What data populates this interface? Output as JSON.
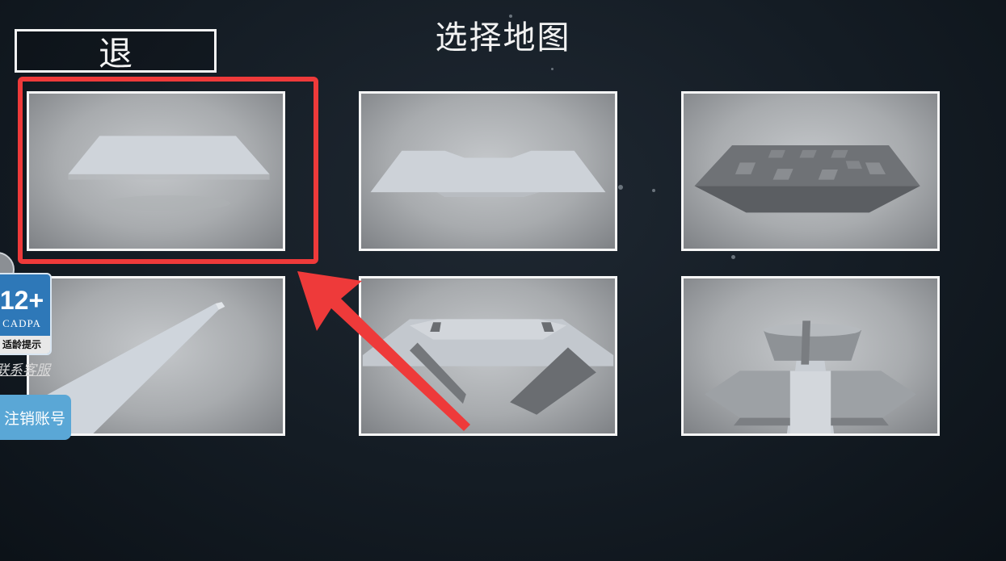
{
  "header": {
    "title": "选择地图",
    "back_label": "退"
  },
  "maps": [
    {
      "name": "flat-platform"
    },
    {
      "name": "valley-platform"
    },
    {
      "name": "pitted-platform"
    },
    {
      "name": "narrow-ramp"
    },
    {
      "name": "twin-tower-arena"
    },
    {
      "name": "fortress"
    }
  ],
  "overlay": {
    "age_rating": "12+",
    "age_org": "CADPA",
    "age_notice": "适龄提示",
    "service_link": "联系客服",
    "deregister_label": "注销账号"
  },
  "colors": {
    "highlight": "#ee3a3a",
    "accent_blue": "#5aa7d6"
  }
}
